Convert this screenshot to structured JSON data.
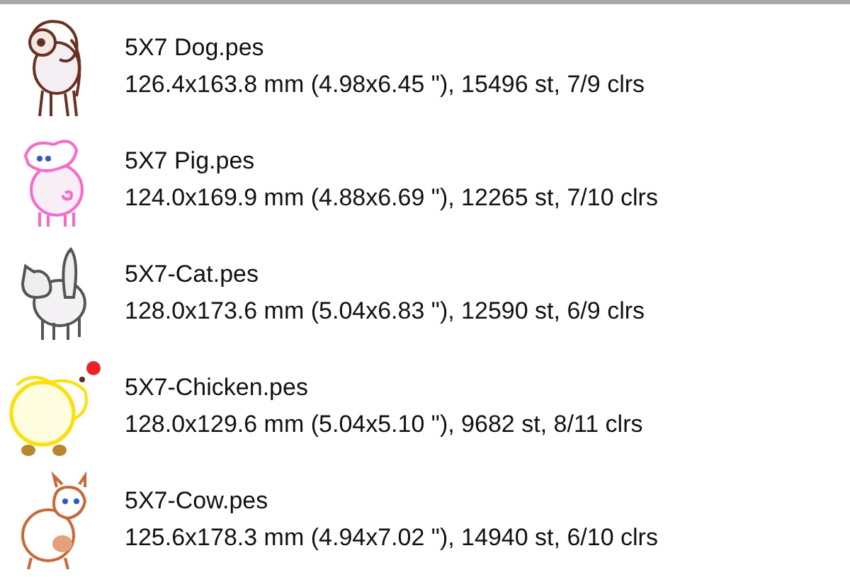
{
  "files": [
    {
      "kind": "dog",
      "name": "5X7 Dog.pes",
      "details": "126.4x163.8 mm (4.98x6.45 \"), 15496 st, 7/9 clrs"
    },
    {
      "kind": "pig",
      "name": "5X7 Pig.pes",
      "details": "124.0x169.9 mm (4.88x6.69 \"), 12265 st, 7/10 clrs"
    },
    {
      "kind": "cat",
      "name": "5X7-Cat.pes",
      "details": "128.0x173.6 mm (5.04x6.83 \"), 12590 st, 6/9 clrs"
    },
    {
      "kind": "chicken",
      "name": "5X7-Chicken.pes",
      "details": "128.0x129.6 mm (5.04x5.10 \"), 9682 st, 8/11 clrs"
    },
    {
      "kind": "cow",
      "name": "5X7-Cow.pes",
      "details": "125.6x178.3 mm (4.94x7.02 \"), 14940 st, 6/10 clrs"
    }
  ]
}
